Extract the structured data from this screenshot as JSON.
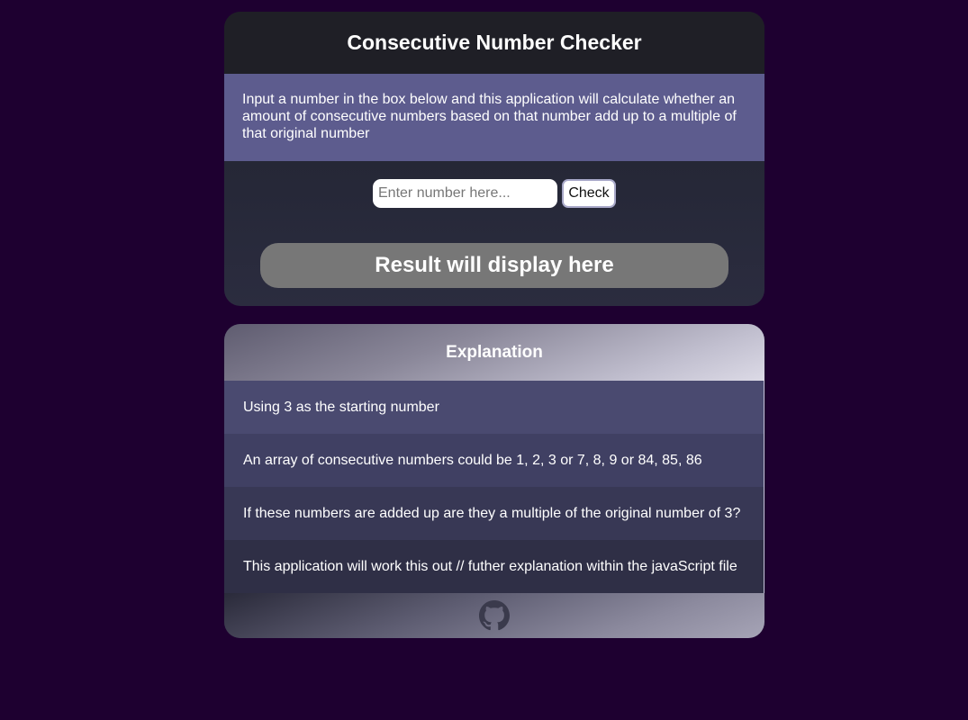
{
  "checker": {
    "title": "Consecutive Number Checker",
    "intro": "Input a number in the box below and this application will calculate whether an amount of consecutive numbers based on that number add up to a multiple of that original number",
    "input_placeholder": "Enter number here...",
    "check_label": "Check",
    "result_text": "Result will display here"
  },
  "explanation": {
    "title": "Explanation",
    "rows": [
      "Using 3 as the starting number",
      "An array of consecutive numbers could be 1, 2, 3 or 7, 8, 9 or 84, 85, 86",
      "If these numbers are added up are they a multiple of the original number of 3?",
      "This application will work this out // futher explanation within the javaScript file"
    ],
    "footer_icon": "github-icon"
  },
  "colors": {
    "page_background": "#1e0030",
    "intro_background": "#5d5c8e",
    "result_background": "#777777"
  }
}
